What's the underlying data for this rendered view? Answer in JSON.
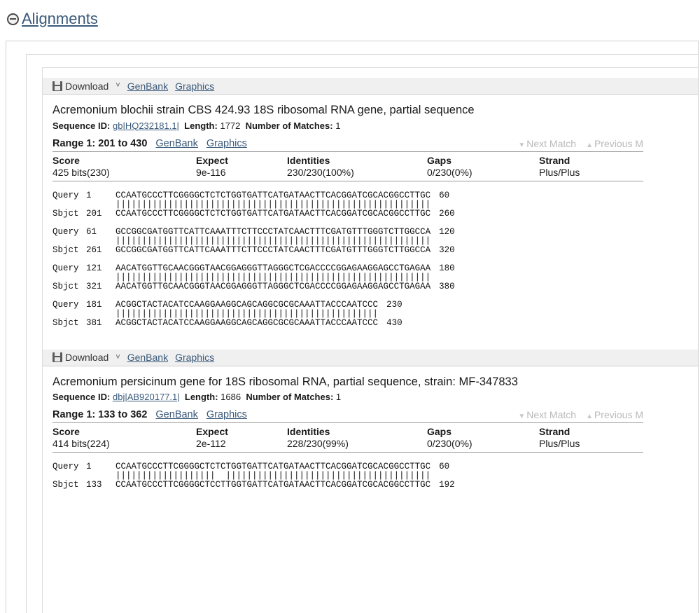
{
  "section": {
    "title": "Alignments",
    "collapse_icon": "minus-circle-icon"
  },
  "toolbar": {
    "download_icon": "save-floppy-icon",
    "download_label": "Download",
    "dropdown_caret": "˅",
    "genbank_label": "GenBank",
    "graphics_label": "Graphics"
  },
  "stats_headers": {
    "score": "Score",
    "expect": "Expect",
    "identities": "Identities",
    "gaps": "Gaps",
    "strand": "Strand"
  },
  "match_nav": {
    "next_icon": "▼",
    "next_label": "Next Match",
    "prev_icon": "▲",
    "prev_label": "Previous M"
  },
  "labels": {
    "sequence_id": "Sequence ID:",
    "length": "Length:",
    "number_of_matches": "Number of Matches:",
    "query": "Query",
    "sbjct": "Sbjct"
  },
  "records": [
    {
      "title": "Acremonium blochii strain CBS 424.93 18S ribosomal RNA gene, partial sequence",
      "sequence_id": "gb|HQ232181.1|",
      "length": "1772",
      "number_of_matches": "1",
      "range_label": "Range 1: 201 to 430",
      "score": "425 bits(230)",
      "expect": "9e-116",
      "identities": "230/230(100%)",
      "gaps": "0/230(0%)",
      "strand": "Plus/Plus",
      "blocks": [
        {
          "query_start": "1",
          "query_seq": "CCAATGCCCTTCGGGGCTCTCTGGTGATTCATGATAACTTCACGGATCGCACGGCCTTGC",
          "query_end": "60",
          "midline": "||||||||||||||||||||||||||||||||||||||||||||||||||||||||||||",
          "sbjct_start": "201",
          "sbjct_seq": "CCAATGCCCTTCGGGGCTCTCTGGTGATTCATGATAACTTCACGGATCGCACGGCCTTGC",
          "sbjct_end": "260"
        },
        {
          "query_start": "61",
          "query_seq": "GCCGGCGATGGTTCATTCAAATTTCTTCCCTATCAACTTTCGATGTTTGGGTCTTGGCCA",
          "query_end": "120",
          "midline": "||||||||||||||||||||||||||||||||||||||||||||||||||||||||||||",
          "sbjct_start": "261",
          "sbjct_seq": "GCCGGCGATGGTTCATTCAAATTTCTTCCCTATCAACTTTCGATGTTTGGGTCTTGGCCA",
          "sbjct_end": "320"
        },
        {
          "query_start": "121",
          "query_seq": "AACATGGTTGCAACGGGTAACGGAGGGTTAGGGCTCGACCCCGGAGAAGGAGCCTGAGAA",
          "query_end": "180",
          "midline": "||||||||||||||||||||||||||||||||||||||||||||||||||||||||||||",
          "sbjct_start": "321",
          "sbjct_seq": "AACATGGTTGCAACGGGTAACGGAGGGTTAGGGCTCGACCCCGGAGAAGGAGCCTGAGAA",
          "sbjct_end": "380"
        },
        {
          "query_start": "181",
          "query_seq": "ACGGCTACTACATCCAAGGAAGGCAGCAGGCGCGCAAATTACCCAATCCC",
          "query_end": "230",
          "midline": "||||||||||||||||||||||||||||||||||||||||||||||||||",
          "sbjct_start": "381",
          "sbjct_seq": "ACGGCTACTACATCCAAGGAAGGCAGCAGGCGCGCAAATTACCCAATCCC",
          "sbjct_end": "430"
        }
      ]
    },
    {
      "title": "Acremonium persicinum gene for 18S ribosomal RNA, partial sequence, strain: MF-347833",
      "sequence_id": "dbj|AB920177.1|",
      "length": "1686",
      "number_of_matches": "1",
      "range_label": "Range 1: 133 to 362",
      "score": "414 bits(224)",
      "expect": "2e-112",
      "identities": "228/230(99%)",
      "gaps": "0/230(0%)",
      "strand": "Plus/Plus",
      "blocks": [
        {
          "query_start": "1",
          "query_seq": "CCAATGCCCTTCGGGGCTCTCTGGTGATTCATGATAACTTCACGGATCGCACGGCCTTGC",
          "query_end": "60",
          "midline": "|||||||||||||||||||  |||||||||||||||||||||||||||||||||||||||",
          "sbjct_start": "133",
          "sbjct_seq": "CCAATGCCCTTCGGGGCTCCTTGGTGATTCATGATAACTTCACGGATCGCACGGCCTTGC",
          "sbjct_end": "192"
        }
      ]
    }
  ],
  "colors": {
    "link": "#3b5a7a",
    "toolbar_bg": "#f0f0f0",
    "text": "#1a1a1a",
    "muted": "#b9b9b9",
    "rule": "#9a9a9a"
  }
}
